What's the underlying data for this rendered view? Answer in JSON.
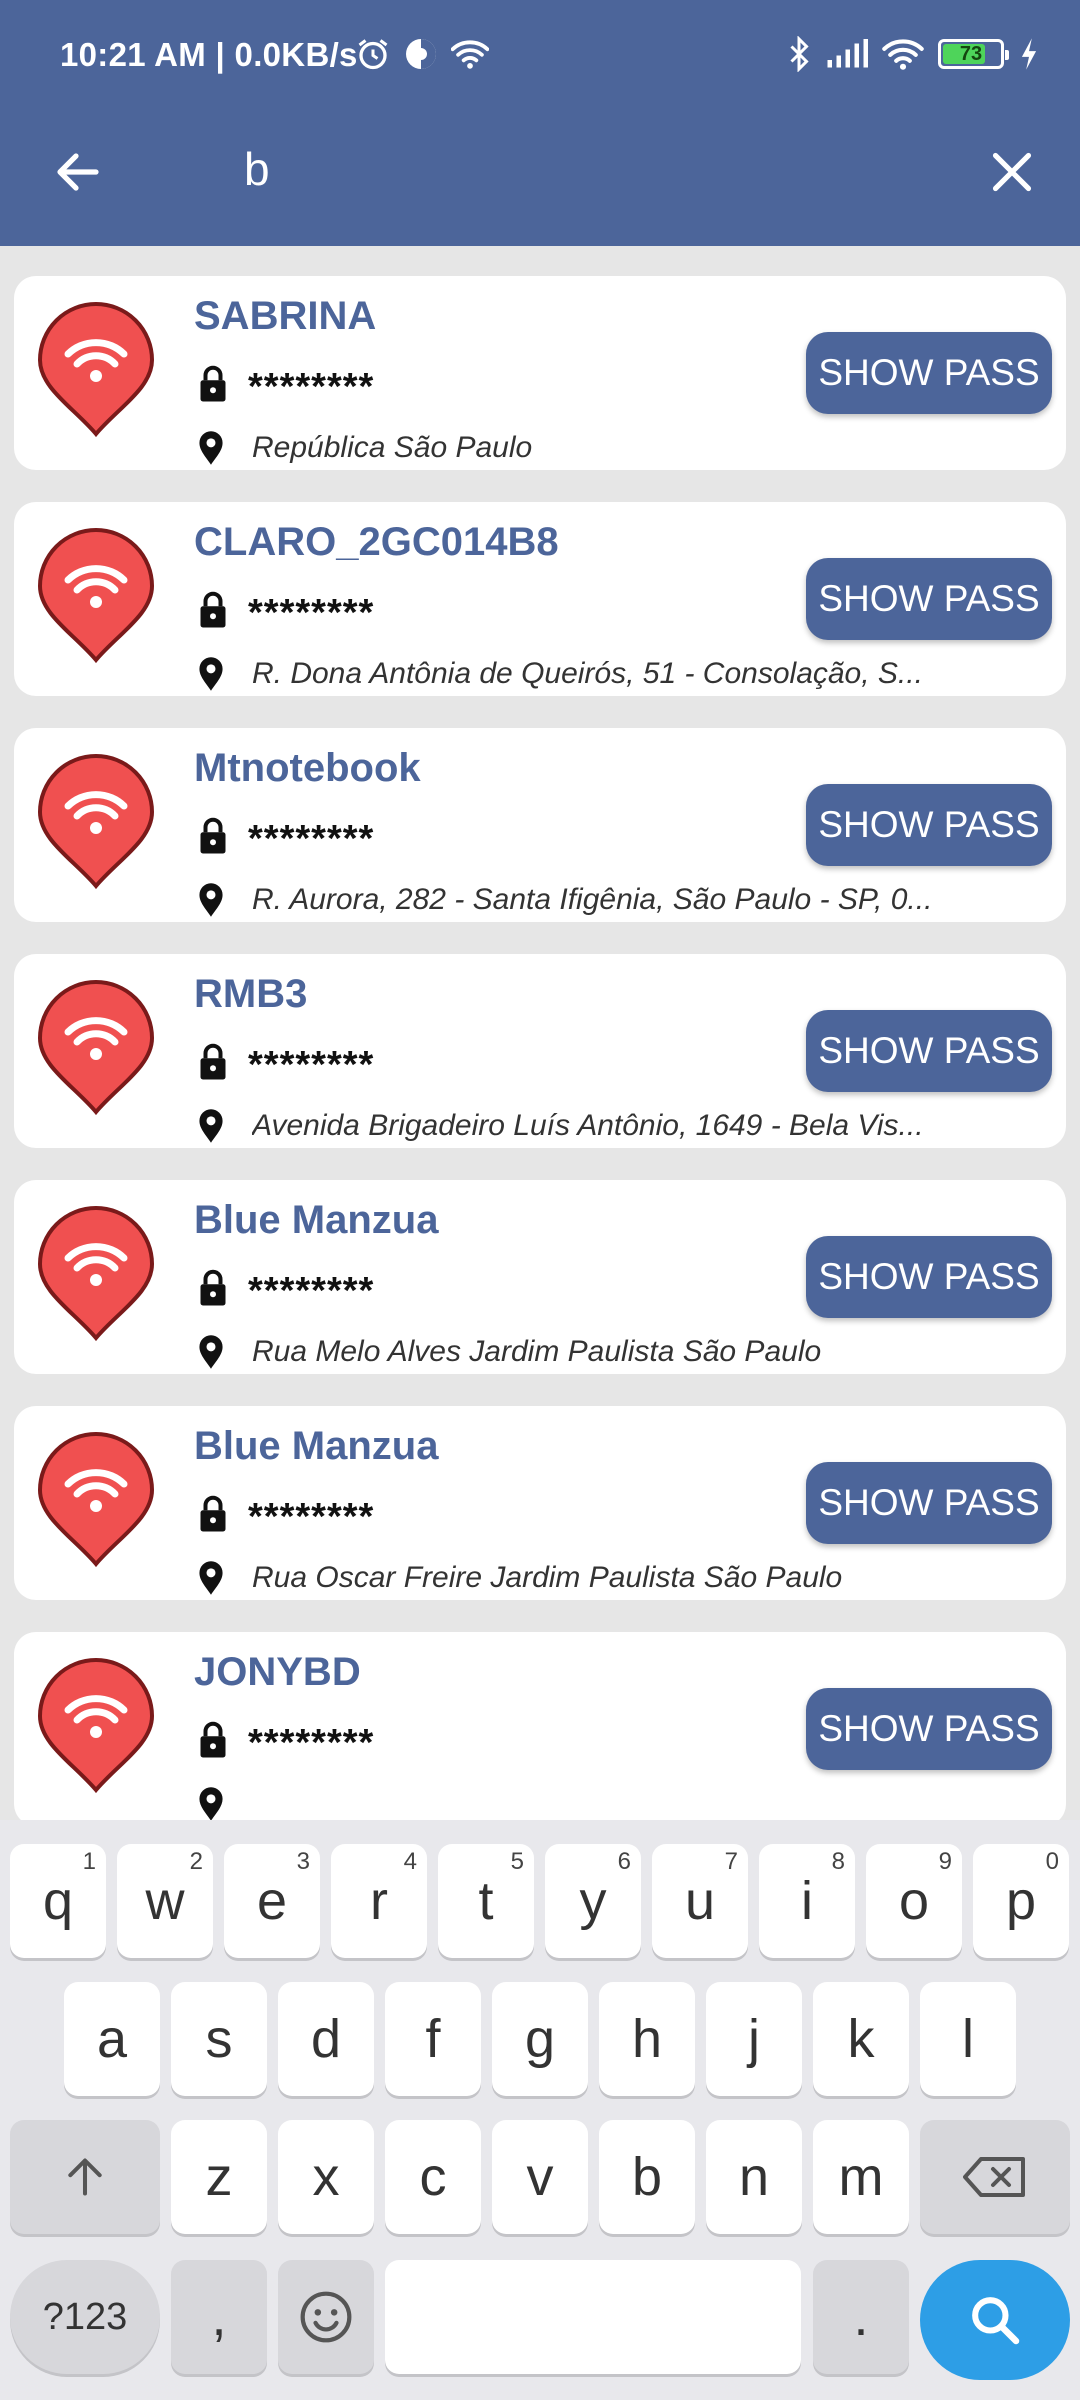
{
  "status_bar": {
    "time": "10:21 AM | 0.0KB/s",
    "battery_level": "73",
    "icons_left": [
      "alarm-icon",
      "data-saver-icon",
      "wifi-icon"
    ],
    "icons_right": [
      "bluetooth-icon",
      "signal-icon",
      "wifi-icon",
      "battery-icon",
      "charging-icon"
    ]
  },
  "search": {
    "query": "b",
    "back_icon": "arrow-left-icon",
    "clear_icon": "close-icon"
  },
  "colors": {
    "primary": "#4c659a",
    "pin_red": "#f05050",
    "search_key": "#2d9ee6"
  },
  "networks": [
    {
      "name": "SABRINA",
      "password_mask": "********",
      "address": " República São Paulo",
      "button": "SHOW PASS"
    },
    {
      "name": "CLARO_2GC014B8",
      "password_mask": "********",
      "address": "R. Dona Antônia de Queirós, 51 - Consolação, S...",
      "button": "SHOW PASS"
    },
    {
      "name": "Mtnotebook",
      "password_mask": "********",
      "address": "R. Aurora, 282 - Santa Ifigênia, São Paulo - SP, 0...",
      "button": "SHOW PASS"
    },
    {
      "name": "RMB3",
      "password_mask": "********",
      "address": "Avenida Brigadeiro Luís Antônio, 1649 - Bela Vis...",
      "button": "SHOW PASS"
    },
    {
      "name": "Blue Manzua",
      "password_mask": "********",
      "address": "Rua Melo Alves Jardim Paulista São Paulo",
      "button": "SHOW PASS"
    },
    {
      "name": "Blue Manzua",
      "password_mask": "********",
      "address": "Rua Oscar Freire Jardim Paulista São Paulo",
      "button": "SHOW PASS"
    },
    {
      "name": "JONYBD",
      "password_mask": "********",
      "address": "",
      "button": "SHOW PASS"
    }
  ],
  "keyboard": {
    "row1": [
      {
        "k": "q",
        "h": "1"
      },
      {
        "k": "w",
        "h": "2"
      },
      {
        "k": "e",
        "h": "3"
      },
      {
        "k": "r",
        "h": "4"
      },
      {
        "k": "t",
        "h": "5"
      },
      {
        "k": "y",
        "h": "6"
      },
      {
        "k": "u",
        "h": "7"
      },
      {
        "k": "i",
        "h": "8"
      },
      {
        "k": "o",
        "h": "9"
      },
      {
        "k": "p",
        "h": "0"
      }
    ],
    "row2": [
      "a",
      "s",
      "d",
      "f",
      "g",
      "h",
      "j",
      "k",
      "l"
    ],
    "row3": [
      "z",
      "x",
      "c",
      "v",
      "b",
      "n",
      "m"
    ],
    "symbols_label": "?123",
    "comma_label": ",",
    "period_label": "."
  }
}
